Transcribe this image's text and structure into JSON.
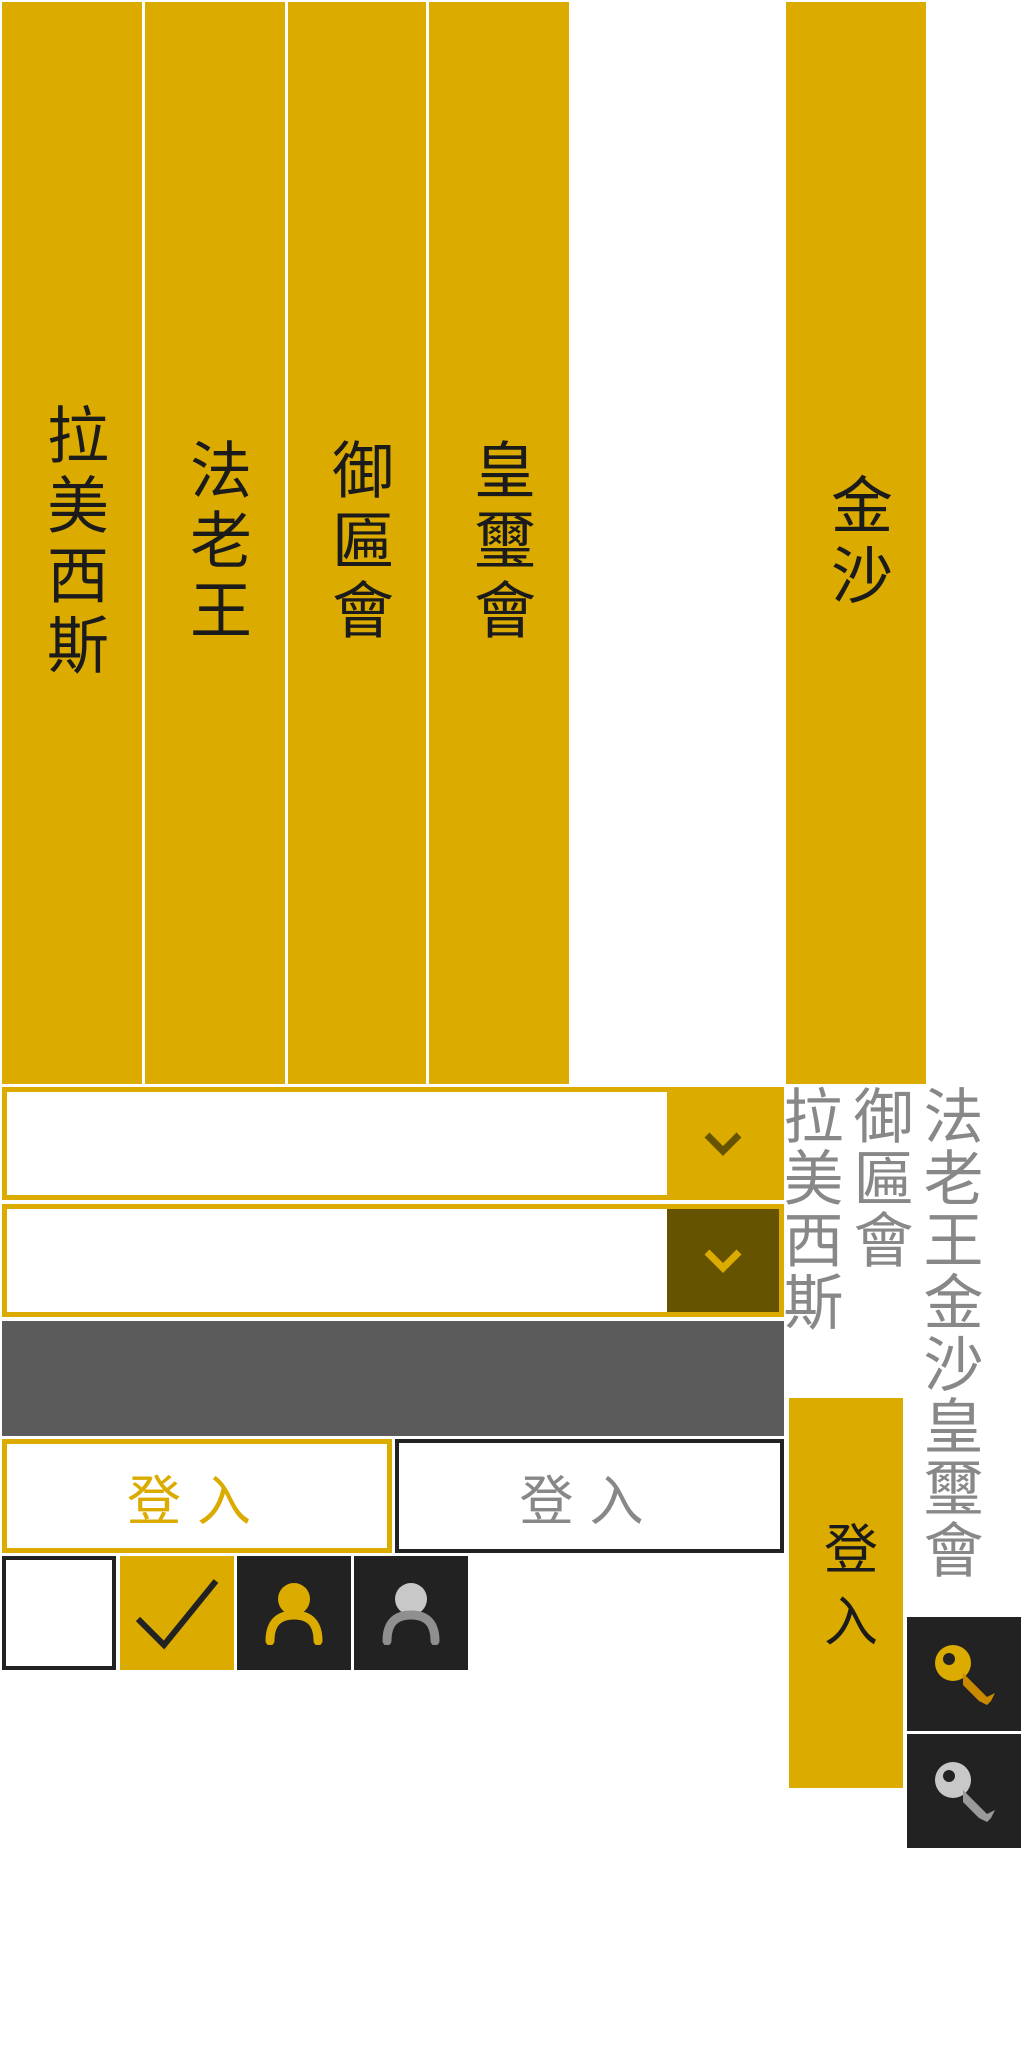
{
  "main_button": {
    "label": "金沙"
  },
  "buttons": [
    {
      "label": "皇璽會"
    },
    {
      "label": "御匾會"
    },
    {
      "label": "法老王"
    },
    {
      "label": "拉美西斯"
    }
  ],
  "list_text": {
    "col1": "法老王金沙皇璽會",
    "col2": "御匾會",
    "col3": "拉美西斯"
  },
  "login": {
    "side_label": "登入",
    "primary_label": "登入",
    "secondary_label": "登入"
  },
  "icons": {
    "dropdown1": "chevron-down-icon",
    "dropdown2": "chevron-down-icon",
    "checkbox_checked": "checkmark-icon",
    "user_gold": "user-icon",
    "user_grey": "user-icon",
    "key_gold": "key-icon",
    "key_grey": "key-icon"
  },
  "colors": {
    "accent": "#dbab00",
    "accent_dark": "#665300",
    "panel_grey": "#5b5b5b",
    "tile_dark": "#222222",
    "grey_text": "#888888",
    "silver": "#c8c8c8"
  }
}
